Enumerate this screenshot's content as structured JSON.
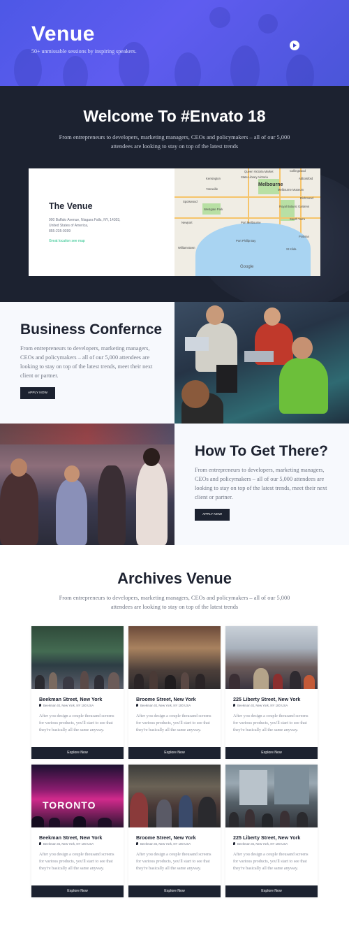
{
  "hero": {
    "title": "Venue",
    "subtitle": "50+ unmissable sessions by inspiring speakers."
  },
  "welcome": {
    "title": "Welcome To #Envato 18",
    "subtitle": "From entrepreneurs to developers, marketing managers, CEOs and policymakers – all of our 5,000 attendees are looking to stay on top of the latest trends",
    "venue": {
      "title": "The Venue",
      "address_line1": "900 Buffalo Avenue, Niagara Falls, NY, 14303,",
      "address_line2": "United States of America,",
      "phone": "855-235-9399",
      "map_link": "Great location see map"
    },
    "map": {
      "city": "Melbourne",
      "labels": [
        "Collingwood",
        "State Library Victoria",
        "Kensington",
        "Richmond",
        "Yarraville",
        "Melbourne Museum",
        "Queen Victoria Market",
        "Abbotsford",
        "Spotswood",
        "Westgate Park",
        "Royal Botanic Gardens",
        "South Yarra",
        "Newport",
        "Port Melbourne",
        "Williamstown",
        "Port Phillip Bay",
        "St Kilda",
        "Prahran"
      ],
      "brand": "Google"
    }
  },
  "business": {
    "title": "Business Confernce",
    "text": "From entrepreneurs to developers, marketing managers, CEOs and policymakers – all of our 5,000 attendees are looking to stay on top of the latest trends, meet their next client or partner.",
    "button": "APPLY NOW"
  },
  "howto": {
    "title": "How To Get There?",
    "text": "From entrepreneurs to developers, marketing managers, CEOs and policymakers – all of our 5,000 attendees are looking to stay on top of the latest trends, meet their next client or partner.",
    "button": "APPLY NOW"
  },
  "archives": {
    "title": "Archives Venue",
    "subtitle": "From entrepreneurs to developers, marketing managers, CEOs and policymakers – all of our 5,000 attendees are looking to stay on top of the latest trends",
    "cards": [
      {
        "title": "Beekman Street, New York",
        "location": "Beekman St, New York, NY 100 USA",
        "desc": "After you design a couple thousand screens for various products, you'll start to see that they're basically all the same anyway.",
        "button": "Explore Now"
      },
      {
        "title": "Broome Street, New York",
        "location": "Beekman St, New York, NY 100 USA",
        "desc": "After you design a couple thousand screens for various products, you'll start to see that they're basically all the same anyway.",
        "button": "Explore Now"
      },
      {
        "title": "225 Liberty Street, New York",
        "location": "Beekman St, New York, NY 100 USA",
        "desc": "After you design a couple thousand screens for various products, you'll start to see that they're basically all the same anyway.",
        "button": "Explore Now"
      },
      {
        "title": "Beekman Street, New York",
        "location": "Beekman St, New York, NY 100 USA",
        "desc": "After you design a couple thousand screens for various products, you'll start to see that they're basically all the same anyway.",
        "button": "Explore Now"
      },
      {
        "title": "Broome Street, New York",
        "location": "Beekman St, New York, NY 100 USA",
        "desc": "After you design a couple thousand screens for various products, you'll start to see that they're basically all the same anyway.",
        "button": "Explore Now"
      },
      {
        "title": "225 Liberty Street, New York",
        "location": "Beekman St, New York, NY 100 USA",
        "desc": "After you design a couple thousand screens for various products, you'll start to see that they're basically all the same anyway.",
        "button": "Explore Now"
      }
    ],
    "photo_sign": "TORONTO"
  },
  "colors": {
    "hero": "#4d58e6",
    "dark": "#1c2230",
    "accent_link": "#25c28a"
  },
  "icons": [
    "play-icon",
    "location-pin-icon"
  ]
}
